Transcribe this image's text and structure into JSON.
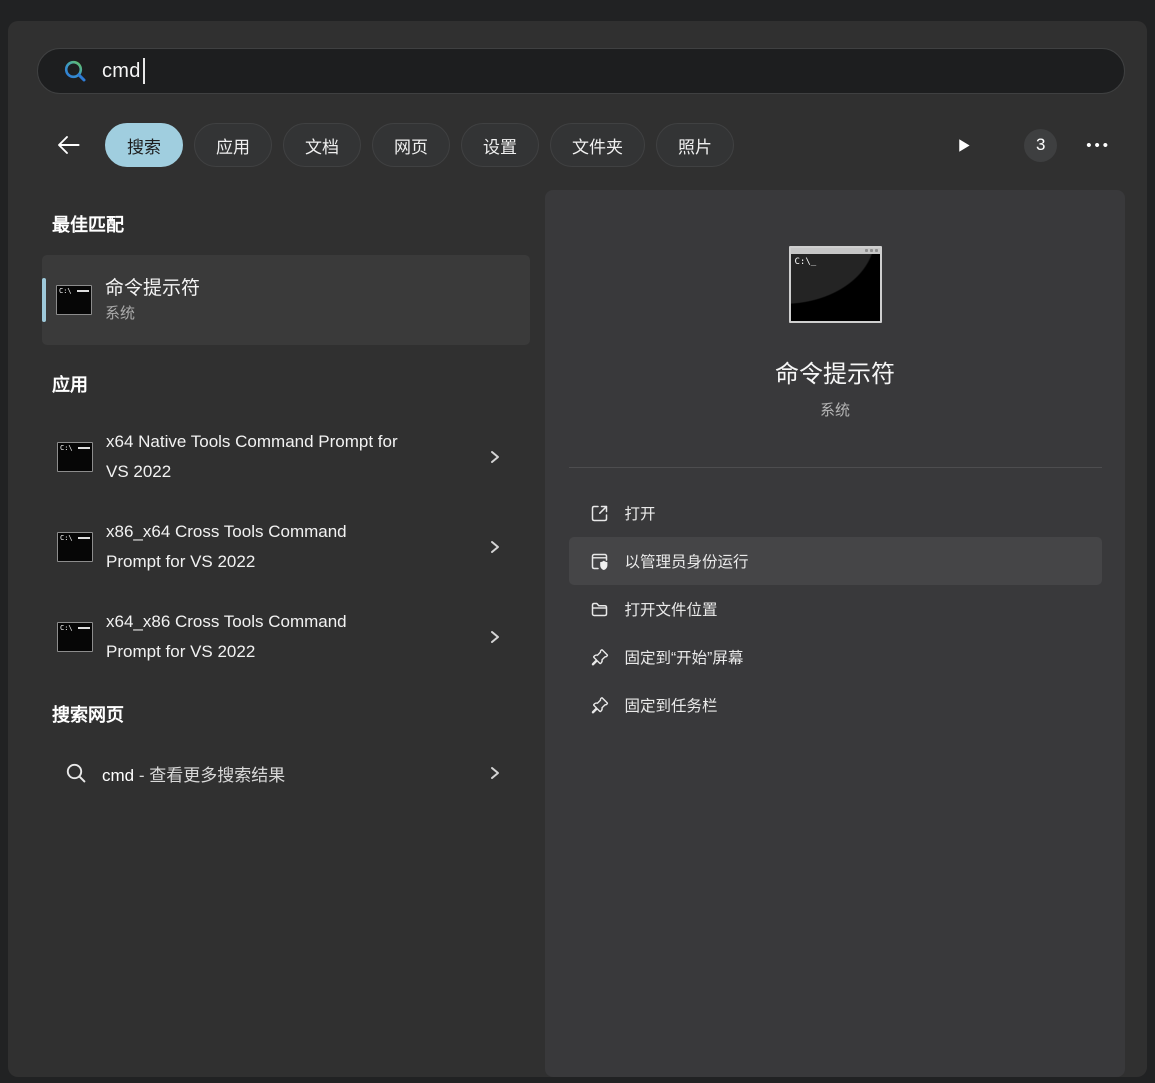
{
  "search": {
    "value": "cmd",
    "icon": "search-icon"
  },
  "nav": {
    "tabs": [
      {
        "label": "搜索",
        "selected": true
      },
      {
        "label": "应用",
        "selected": false
      },
      {
        "label": "文档",
        "selected": false
      },
      {
        "label": "网页",
        "selected": false
      },
      {
        "label": "设置",
        "selected": false
      },
      {
        "label": "文件夹",
        "selected": false
      },
      {
        "label": "照片",
        "selected": false
      }
    ],
    "badge_count": "3",
    "more_label": "•••"
  },
  "results": {
    "best": {
      "header": "最佳匹配",
      "item": {
        "title": "命令提示符",
        "subtitle": "系统"
      }
    },
    "apps": {
      "header": "应用",
      "items": [
        {
          "title": "x64 Native Tools Command Prompt for VS 2022"
        },
        {
          "title": "x86_x64 Cross Tools Command Prompt for VS 2022"
        },
        {
          "title": "x64_x86 Cross Tools Command Prompt for VS 2022"
        }
      ]
    },
    "web": {
      "header": "搜索网页",
      "item": {
        "query": "cmd",
        "suffix": " - 查看更多搜索结果"
      }
    }
  },
  "preview": {
    "title": "命令提示符",
    "subtitle": "系统",
    "actions": [
      {
        "label": "打开",
        "icon": "open-external-icon",
        "highlighted": false
      },
      {
        "label": "以管理员身份运行",
        "icon": "run-as-admin-icon",
        "highlighted": true
      },
      {
        "label": "打开文件位置",
        "icon": "folder-icon",
        "highlighted": false
      },
      {
        "label": "固定到“开始”屏幕",
        "icon": "pin-icon",
        "highlighted": false
      },
      {
        "label": "固定到任务栏",
        "icon": "pin-icon",
        "highlighted": false
      }
    ]
  },
  "cmd_icon": {
    "small_prompt": "C:\\",
    "large_prompt": "C:\\_"
  },
  "colors": {
    "accent_bar": "#9ec9da",
    "selected_tab": "#a0cedf",
    "window_bg": "#303030",
    "panel_bg": "#39393b",
    "outer_bg": "#212223",
    "search_bg": "#1d1e1f",
    "highlight_row": "#454547"
  }
}
